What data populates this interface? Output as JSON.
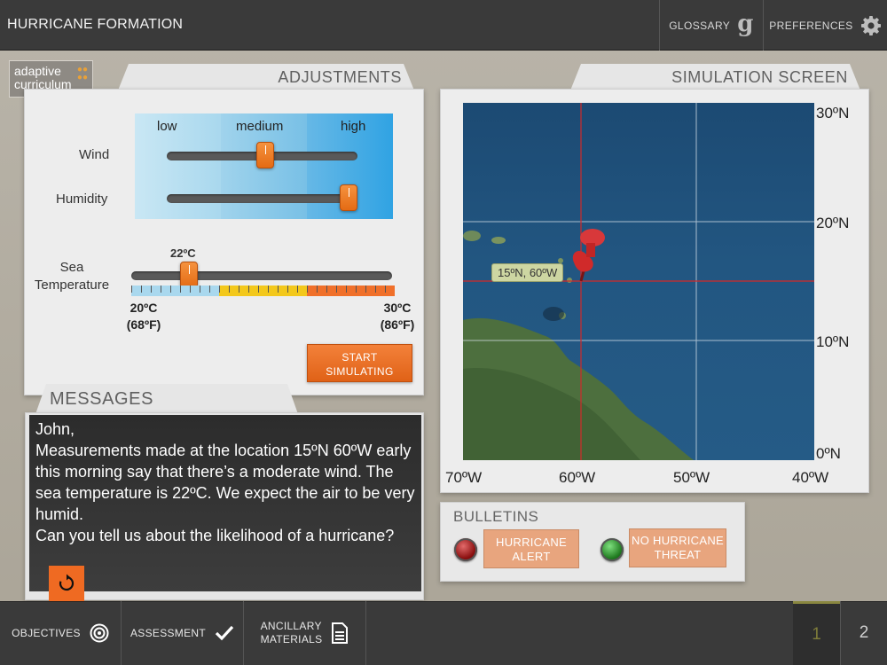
{
  "app": {
    "title": "HURRICANE FORMATION",
    "glossary_label": "GLOSSARY",
    "preferences_label": "PREFERENCES",
    "logo_line1": "adaptive",
    "logo_line2": "curriculum"
  },
  "adjustments": {
    "tab_label": "ADJUSTMENTS",
    "scale_labels": [
      "low",
      "medium",
      "high"
    ],
    "wind_label": "Wind",
    "wind_level": 0.52,
    "humidity_label": "Humidity",
    "humidity_level": 1.0,
    "sea_temp_label_line1": "Sea",
    "sea_temp_label_line2": "Temperature",
    "sea_temp_value": "22ºC",
    "sea_temp_level": 0.2,
    "min_c": "20ºC",
    "min_f": "(68ºF)",
    "max_c": "30ºC",
    "max_f": "(86ºF)",
    "start_label_line1": "START",
    "start_label_line2": "SIMULATING"
  },
  "messages": {
    "tab_label": "MESSAGES",
    "lines": [
      "John,",
      "Measurements made at the location 15ºN 60ºW early this morning say that there’s a moderate wind. The sea temperature is 22ºC. We expect the air to be very humid.",
      "Can you tell us about the likelihood of a hurricane?"
    ]
  },
  "simulation": {
    "tab_label": "SIMULATION SCREEN",
    "lat_labels": [
      "30ºN",
      "20ºN",
      "10ºN",
      "0ºN"
    ],
    "lon_labels": [
      "70ºW",
      "60ºW",
      "50ºW",
      "40ºW"
    ],
    "pin_label": "15ºN, 60ºW",
    "pin_lat": 15,
    "pin_lon": -60
  },
  "bulletins": {
    "title": "BULLETINS",
    "hurricane_alert_line1": "HURRICANE",
    "hurricane_alert_line2": "ALERT",
    "no_hurricane_line1": "NO HURRICANE",
    "no_hurricane_line2": "THREAT"
  },
  "bottom": {
    "objectives_label": "OBJECTIVES",
    "assessment_label": "ASSESSMENT",
    "ancillary_line1": "ANCILLARY",
    "ancillary_line2": "MATERIALS",
    "pages": [
      "1",
      "2"
    ],
    "current_page": "1"
  },
  "colors": {
    "accent_orange": "#ef6a22",
    "topbar": "#3a3a3a",
    "led_red": "#8a0f0f",
    "led_green": "#1f7a1f"
  }
}
